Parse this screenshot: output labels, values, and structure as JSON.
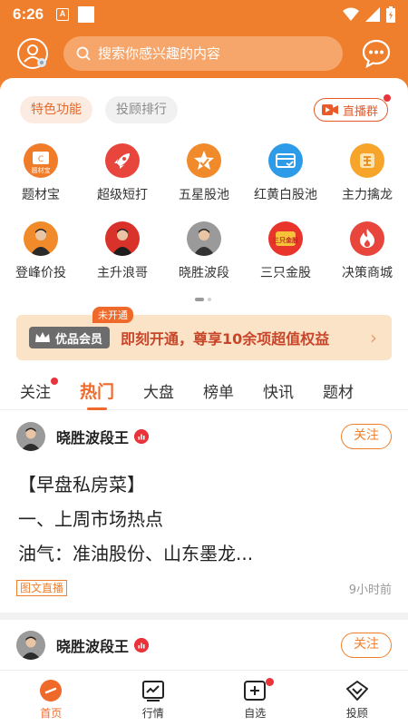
{
  "status_bar": {
    "time": "6:26",
    "a_icon": "A"
  },
  "header": {
    "search_placeholder": "搜索你感兴趣的内容"
  },
  "top_tabs": [
    {
      "label": "特色功能",
      "active": true
    },
    {
      "label": "投顾排行",
      "active": false
    }
  ],
  "live_group_label": "直播群",
  "features_row1": [
    {
      "label": "题材宝",
      "icon": "theme-treasure-icon",
      "color": "#f07c2a"
    },
    {
      "label": "超级短打",
      "icon": "rocket-icon",
      "color": "#e8453c"
    },
    {
      "label": "五星股池",
      "icon": "star-icon",
      "color": "#f08a2a"
    },
    {
      "label": "红黄白股池",
      "icon": "card-icon",
      "color": "#2e9be8"
    },
    {
      "label": "主力擒龙",
      "icon": "dragon-icon",
      "color": "#f7a42a"
    }
  ],
  "features_row2": [
    {
      "label": "登峰价投",
      "icon": "advisor-avatar-icon",
      "color": "#f08a2a"
    },
    {
      "label": "主升浪哥",
      "icon": "advisor-avatar-icon",
      "color": "#d8322a"
    },
    {
      "label": "晓胜波段",
      "icon": "advisor-avatar-icon",
      "color": "#8a8a8a"
    },
    {
      "label": "三只金股",
      "icon": "gold-stock-icon",
      "color": "#e8342a"
    },
    {
      "label": "决策商城",
      "icon": "flame-icon",
      "color": "#e8453c"
    }
  ],
  "feature_row1_icon1_text": "题材宝",
  "feature_row2_icon4_text": "三只金股",
  "vip": {
    "badge": "优品会员",
    "tag": "未开通",
    "text": "即刻开通，尊享10余项超值权益",
    "arrow": "›"
  },
  "content_tabs": [
    {
      "label": "关注",
      "active": false,
      "dot": true
    },
    {
      "label": "热门",
      "active": true,
      "dot": false
    },
    {
      "label": "大盘",
      "active": false,
      "dot": false
    },
    {
      "label": "榜单",
      "active": false,
      "dot": false
    },
    {
      "label": "快讯",
      "active": false,
      "dot": false
    },
    {
      "label": "题材",
      "active": false,
      "dot": false
    }
  ],
  "post1": {
    "author": "晓胜波段王",
    "follow": "关注",
    "lines": [
      "【早盘私房菜】",
      "一、上周市场热点",
      "油气：准油股份、山东墨龙..."
    ],
    "tag": "图文直播",
    "time": "9小时前"
  },
  "post2": {
    "author": "晓胜波段王",
    "follow": "关注"
  },
  "bottom_nav": [
    {
      "label": "首页",
      "icon": "home-icon",
      "active": true
    },
    {
      "label": "行情",
      "icon": "market-chart-icon",
      "active": false
    },
    {
      "label": "自选",
      "icon": "watchlist-add-icon",
      "active": false
    },
    {
      "label": "投顾",
      "icon": "advisor-icon",
      "active": false
    }
  ],
  "colors": {
    "brand_orange": "#ef7f2d",
    "accent_red": "#e8343a"
  }
}
